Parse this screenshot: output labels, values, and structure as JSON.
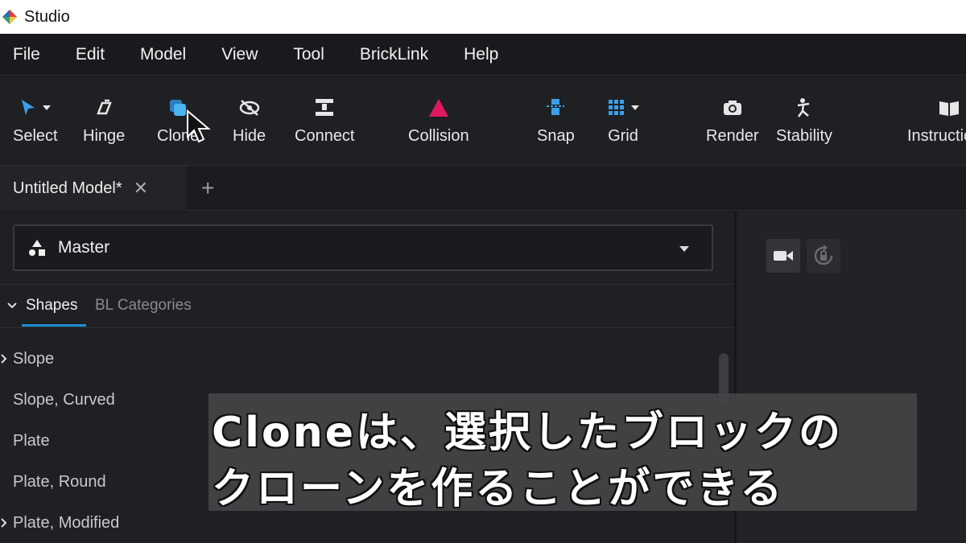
{
  "window": {
    "title": "Studio"
  },
  "menu": [
    "File",
    "Edit",
    "Model",
    "View",
    "Tool",
    "BrickLink",
    "Help"
  ],
  "toolbar": {
    "select": "Select",
    "hinge": "Hinge",
    "clone": "Clone",
    "hide": "Hide",
    "connect": "Connect",
    "collision": "Collision",
    "snap": "Snap",
    "grid": "Grid",
    "render": "Render",
    "stability": "Stability",
    "instructions": "Instructions"
  },
  "tabs": {
    "active": "Untitled Model*",
    "close": "✕",
    "add": "+"
  },
  "palette": {
    "selected": "Master"
  },
  "subtabs": {
    "shapes": "Shapes",
    "bl_categories": "BL Categories"
  },
  "categories": [
    "Slope",
    "Slope, Curved",
    "Plate",
    "Plate, Round",
    "Plate, Modified"
  ],
  "caption": {
    "line1": "Cloneは、選択したブロックの",
    "line2": "クローンを作ることができる"
  },
  "colors": {
    "accent_blue": "#1e8fd6",
    "collision_pink": "#e0195e",
    "select_blue": "#3aa0e8"
  }
}
